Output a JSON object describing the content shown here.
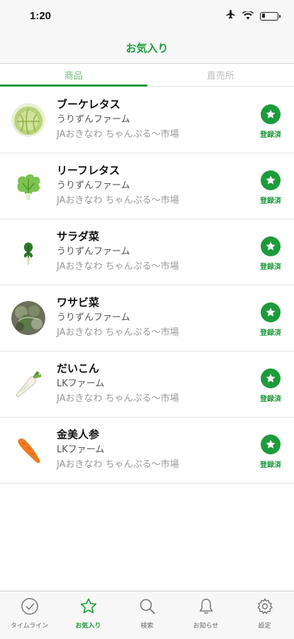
{
  "status_bar": {
    "time": "1:20",
    "icons": [
      "airplane-icon",
      "wifi-icon",
      "battery-icon"
    ],
    "battery_level": 0.2
  },
  "header": {
    "title": "お気入り"
  },
  "tabs": [
    {
      "label": "商品",
      "active": true
    },
    {
      "label": "直売所",
      "active": false
    }
  ],
  "items": [
    {
      "name": "ブーケレタス",
      "farm": "うりずんファーム",
      "market": "JAおきなわ ちゃんぷる〜市場",
      "status": "登録済",
      "thumb_icon": "lettuce-icon"
    },
    {
      "name": "リーフレタス",
      "farm": "うりずんファーム",
      "market": "JAおきなわ ちゃんぷる〜市場",
      "status": "登録済",
      "thumb_icon": "leaf-lettuce-icon"
    },
    {
      "name": "サラダ菜",
      "farm": "うりずんファーム",
      "market": "JAおきなわ ちゃんぷる〜市場",
      "status": "登録済",
      "thumb_icon": "salad-greens-icon"
    },
    {
      "name": "ワサビ菜",
      "farm": "うりずんファーム",
      "market": "JAおきなわ ちゃんぷる〜市場",
      "status": "登録済",
      "thumb_icon": "wasabi-greens-icon"
    },
    {
      "name": "だいこん",
      "farm": "LKファーム",
      "market": "JAおきなわ ちゃんぷる〜市場",
      "status": "登録済",
      "thumb_icon": "daikon-icon"
    },
    {
      "name": "金美人参",
      "farm": "LKファーム",
      "market": "JAおきなわ ちゃんぷる〜市場",
      "status": "登録済",
      "thumb_icon": "carrot-icon"
    }
  ],
  "tabbar": [
    {
      "label": "タイムライン",
      "icon": "clock-check-icon",
      "active": false
    },
    {
      "label": "お気入り",
      "icon": "star-icon",
      "active": true
    },
    {
      "label": "検索",
      "icon": "search-icon",
      "active": false
    },
    {
      "label": "お知らせ",
      "icon": "bell-icon",
      "active": false
    },
    {
      "label": "設定",
      "icon": "gear-icon",
      "active": false
    }
  ],
  "colors": {
    "accent": "#1d9b3c",
    "tab_inactive": "#bdbdbd",
    "bar_bg": "#f7f7f7"
  }
}
